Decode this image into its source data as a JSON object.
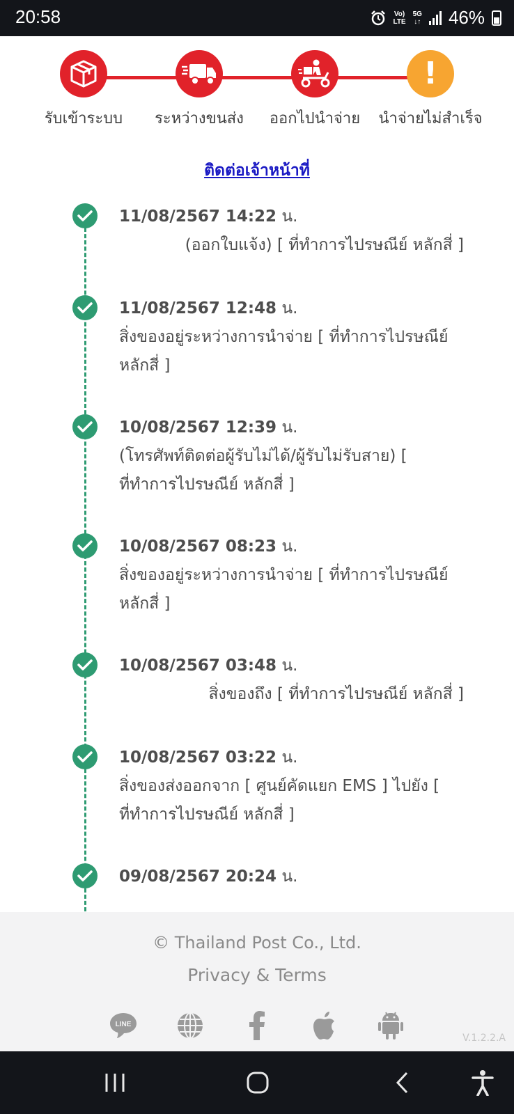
{
  "status_bar": {
    "time": "20:58",
    "net_top": "Vo)",
    "net_bottom": "LTE",
    "net2_top": "5G",
    "net2_bottom": "↓↑",
    "battery": "46%"
  },
  "steps": [
    {
      "label": "รับเข้าระบบ",
      "icon": "package-icon",
      "state": "done"
    },
    {
      "label": "ระหว่างขนส่ง",
      "icon": "truck-icon",
      "state": "done"
    },
    {
      "label": "ออกไปนำจ่าย",
      "icon": "scooter-delivery-icon",
      "state": "done"
    },
    {
      "label": "นำจ่ายไม่สำเร็จ",
      "icon": "exclamation-icon",
      "state": "warning",
      "mark": "!"
    }
  ],
  "contact_link": "ติดต่อเจ้าหน้าที่",
  "events": [
    {
      "date": "11/08/2567 14:22",
      "unit": "น.",
      "desc": "(ออกใบแจ้ง) [ ที่ทำการไปรษณีย์ หลักสี่ ]"
    },
    {
      "date": "11/08/2567 12:48",
      "unit": "น.",
      "desc": "สิ่งของอยู่ระหว่างการนำจ่าย [ ที่ทำการไปรษณีย์ หลักสี่ ]"
    },
    {
      "date": "10/08/2567 12:39",
      "unit": "น.",
      "desc": "(โทรศัพท์ติดต่อผู้รับไม่ได้/ผู้รับไม่รับสาย) [ ที่ทำการไปรษณีย์ หลักสี่ ]"
    },
    {
      "date": "10/08/2567 08:23",
      "unit": "น.",
      "desc": "สิ่งของอยู่ระหว่างการนำจ่าย [ ที่ทำการไปรษณีย์ หลักสี่ ]"
    },
    {
      "date": "10/08/2567 03:48",
      "unit": "น.",
      "desc": "สิ่งของถึง [ ที่ทำการไปรษณีย์ หลักสี่ ]"
    },
    {
      "date": "10/08/2567 03:22",
      "unit": "น.",
      "desc": "สิ่งของส่งออกจาก [ ศูนย์คัดแยก EMS ] ไปยัง [ ที่ทำการไปรษณีย์ หลักสี่ ]"
    },
    {
      "date": "09/08/2567 20:24",
      "unit": "น.",
      "desc": ""
    }
  ],
  "footer": {
    "copyright": "© Thailand Post Co., Ltd.",
    "privacy": "Privacy & Terms",
    "version": "V.1.2.2.A",
    "line_text": "LINE",
    "social": [
      "line-icon",
      "globe-icon",
      "facebook-icon",
      "apple-icon",
      "android-icon"
    ]
  },
  "colors": {
    "step_red": "#e1222a",
    "step_warning": "#f7a531",
    "timeline_green": "#2e9b72",
    "link_blue": "#1a19c4"
  }
}
